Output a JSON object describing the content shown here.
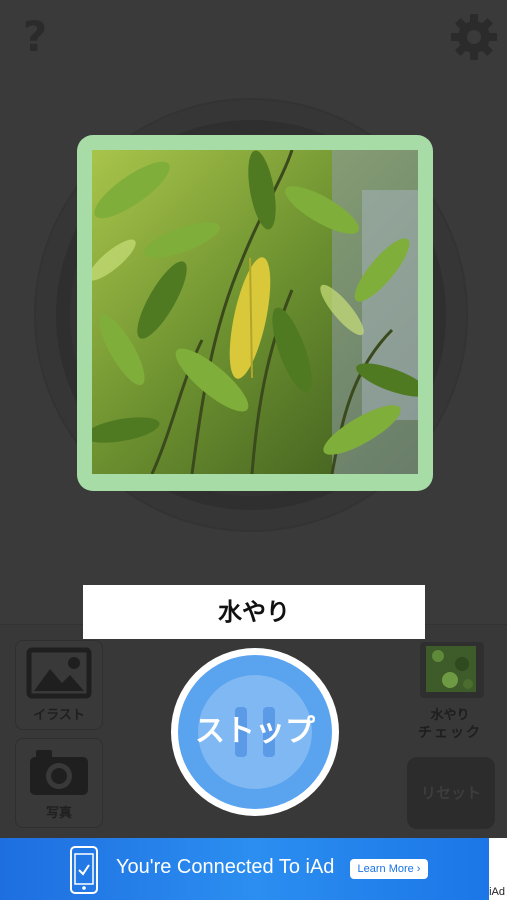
{
  "header": {
    "help_icon": "?",
    "settings_icon": "gear-icon"
  },
  "photo": {
    "subject": ""
  },
  "label": {
    "text": "水やり"
  },
  "left_buttons": {
    "illust_label": "イラスト",
    "photo_label": "写真"
  },
  "right_panel": {
    "thumb_label1": "水やり",
    "thumb_label2": "チェック",
    "reset_label": "リセット"
  },
  "main_button": {
    "label": "ストップ"
  },
  "ad": {
    "text": "You're Connected To iAd",
    "button": "Learn More ›",
    "brand": "iAd"
  },
  "colors": {
    "background": "#3a3a3a",
    "frame": "#a8dca7",
    "button_blue": "#5aa3ef",
    "ad_blue": "#2b8ef0"
  }
}
